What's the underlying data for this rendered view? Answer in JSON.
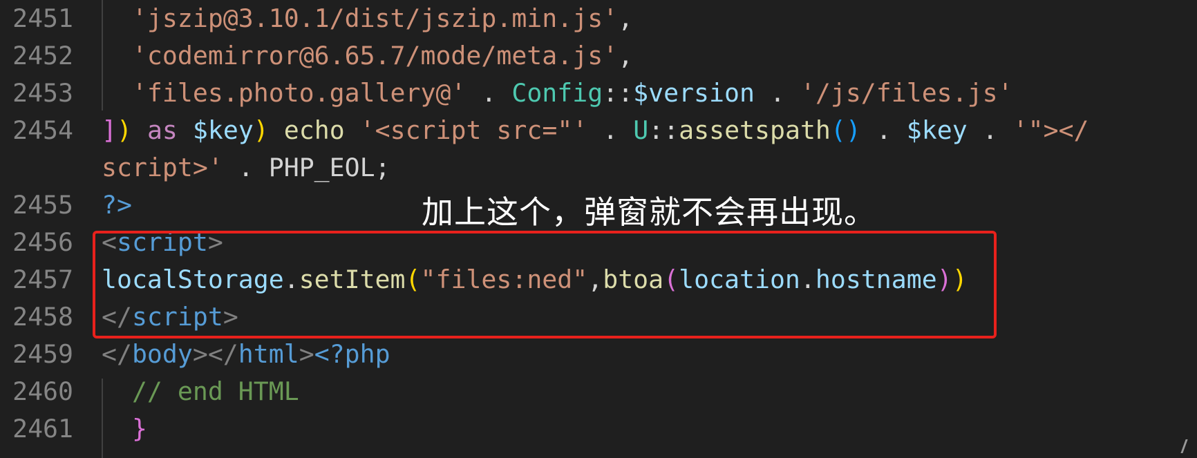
{
  "editor": {
    "lines": [
      {
        "number": "2451",
        "indent": "  ",
        "tokens": [
          {
            "t": "'jszip@3.10.1/dist/jszip.min.js'",
            "c": "t-str"
          },
          {
            "t": ",",
            "c": "t-plain"
          }
        ]
      },
      {
        "number": "2452",
        "indent": "  ",
        "tokens": [
          {
            "t": "'codemirror@6.65.7/mode/meta.js'",
            "c": "t-str"
          },
          {
            "t": ",",
            "c": "t-plain"
          }
        ]
      },
      {
        "number": "2453",
        "indent": "  ",
        "tokens": [
          {
            "t": "'files.photo.gallery@'",
            "c": "t-str"
          },
          {
            "t": " . ",
            "c": "t-plain"
          },
          {
            "t": "Config",
            "c": "t-cls"
          },
          {
            "t": "::",
            "c": "t-plain"
          },
          {
            "t": "$version",
            "c": "t-var"
          },
          {
            "t": " . ",
            "c": "t-plain"
          },
          {
            "t": "'/js/files.js'",
            "c": "t-str"
          }
        ]
      },
      {
        "number": "2454",
        "indent": "",
        "tokens": [
          {
            "t": "]",
            "c": "t-br2"
          },
          {
            "t": ")",
            "c": "t-br1"
          },
          {
            "t": " ",
            "c": "t-plain"
          },
          {
            "t": "as",
            "c": "t-kw"
          },
          {
            "t": " ",
            "c": "t-plain"
          },
          {
            "t": "$key",
            "c": "t-var"
          },
          {
            "t": ")",
            "c": "t-br1"
          },
          {
            "t": " ",
            "c": "t-plain"
          },
          {
            "t": "echo",
            "c": "t-fn"
          },
          {
            "t": " ",
            "c": "t-plain"
          },
          {
            "t": "'<script src=\"'",
            "c": "t-str"
          },
          {
            "t": " . ",
            "c": "t-plain"
          },
          {
            "t": "U",
            "c": "t-cls"
          },
          {
            "t": "::",
            "c": "t-plain"
          },
          {
            "t": "assetspath",
            "c": "t-fn"
          },
          {
            "t": "()",
            "c": "t-br3"
          },
          {
            "t": " . ",
            "c": "t-plain"
          },
          {
            "t": "$key",
            "c": "t-var"
          },
          {
            "t": " . ",
            "c": "t-plain"
          },
          {
            "t": "'\"></",
            "c": "t-str"
          }
        ]
      },
      {
        "number": "",
        "indent": "",
        "tokens": [
          {
            "t": "script>'",
            "c": "t-str"
          },
          {
            "t": " . ",
            "c": "t-plain"
          },
          {
            "t": "PHP_EOL",
            "c": "t-plain"
          },
          {
            "t": ";",
            "c": "t-plain"
          }
        ]
      },
      {
        "number": "2455",
        "indent": "",
        "tokens": [
          {
            "t": "?>",
            "c": "t-tag"
          }
        ]
      },
      {
        "number": "2456",
        "indent": "",
        "tokens": [
          {
            "t": "<",
            "c": "t-pun"
          },
          {
            "t": "script",
            "c": "t-tag"
          },
          {
            "t": ">",
            "c": "t-pun"
          }
        ]
      },
      {
        "number": "2457",
        "indent": "",
        "tokens": [
          {
            "t": "localStorage",
            "c": "t-var"
          },
          {
            "t": ".",
            "c": "t-plain"
          },
          {
            "t": "setItem",
            "c": "t-fn"
          },
          {
            "t": "(",
            "c": "t-br1"
          },
          {
            "t": "\"files:ned\"",
            "c": "t-str"
          },
          {
            "t": ",",
            "c": "t-plain"
          },
          {
            "t": "btoa",
            "c": "t-fn"
          },
          {
            "t": "(",
            "c": "t-br2"
          },
          {
            "t": "location",
            "c": "t-var"
          },
          {
            "t": ".",
            "c": "t-plain"
          },
          {
            "t": "hostname",
            "c": "t-var"
          },
          {
            "t": ")",
            "c": "t-br2"
          },
          {
            "t": ")",
            "c": "t-br1"
          }
        ]
      },
      {
        "number": "2458",
        "indent": "",
        "tokens": [
          {
            "t": "</",
            "c": "t-pun"
          },
          {
            "t": "script",
            "c": "t-tag"
          },
          {
            "t": ">",
            "c": "t-pun"
          }
        ]
      },
      {
        "number": "2459",
        "indent": "",
        "tokens": [
          {
            "t": "</",
            "c": "t-pun"
          },
          {
            "t": "body",
            "c": "t-tag"
          },
          {
            "t": "></",
            "c": "t-pun"
          },
          {
            "t": "html",
            "c": "t-tag"
          },
          {
            "t": ">",
            "c": "t-pun"
          },
          {
            "t": "<?php",
            "c": "t-tag"
          }
        ]
      },
      {
        "number": "2460",
        "indent": "  ",
        "tokens": [
          {
            "t": "// end HTML",
            "c": "t-cmt"
          }
        ]
      },
      {
        "number": "2461",
        "indent": "  ",
        "tokens": [
          {
            "t": "}",
            "c": "t-br2"
          }
        ]
      }
    ]
  },
  "caption": "加上这个，弹窗就不会再出现。",
  "colors": {
    "background": "#1f1f1f",
    "line_number": "#858585",
    "highlight_border": "#e8211c",
    "caption_text": "#ffffff"
  },
  "icons": [
    "resize-cursor-icon"
  ]
}
